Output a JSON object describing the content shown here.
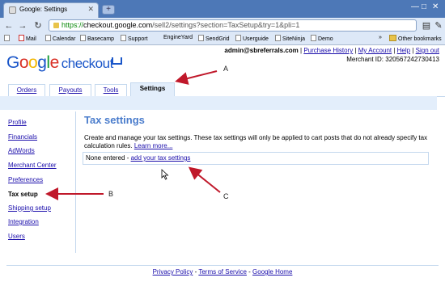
{
  "browser": {
    "tab_title": "Google: Settings",
    "close_glyph": "✕",
    "newtab_glyph": "+",
    "url_https": "https://",
    "url_host": "checkout.google.com",
    "url_rest": "/sell2/settings?section=TaxSetup&try=1&pli=1",
    "window_controls": [
      "—",
      "□",
      "✕"
    ],
    "bookmarks": [
      "Mail",
      "Calendar",
      "Basecamp",
      "Support",
      "EngineYard",
      "SendGrid",
      "Userguide",
      "SiteNinja",
      "Demo"
    ],
    "other_bookmarks": "Other bookmarks"
  },
  "header": {
    "logo_letters": [
      "G",
      "o",
      "o",
      "g",
      "l",
      "e"
    ],
    "logo_product": "checkout",
    "user_email": "admin@sbreferrals.com",
    "sep": " | ",
    "links": [
      "Purchase History",
      "My Account",
      "Help",
      "Sign out"
    ],
    "merchant_label": "Merchant ID: 320567242730413"
  },
  "main_tabs": [
    "Orders",
    "Payouts",
    "Tools",
    "Settings"
  ],
  "active_tab": "Settings",
  "sidebar": [
    "Profile",
    "Financials",
    "AdWords",
    "Merchant Center",
    "Preferences",
    "Tax setup",
    "Shipping setup",
    "Integration",
    "Users"
  ],
  "selected_sidebar": "Tax setup",
  "content": {
    "title": "Tax settings",
    "description": "Create and manage your tax settings. These tax settings will only be applied to cart posts that do not already specify tax calculation rules.",
    "learn_more": "Learn more...",
    "none_entered": "None entered - ",
    "add_link": "add your tax settings"
  },
  "footer": {
    "links": [
      "Privacy Policy",
      "Terms of Service",
      "Google Home"
    ],
    "sep": " - "
  },
  "annotations": [
    "A",
    "B",
    "C"
  ],
  "colors": {
    "arrow": "#c0182a",
    "title": "#4a7ccc",
    "link": "#1a0dab"
  }
}
